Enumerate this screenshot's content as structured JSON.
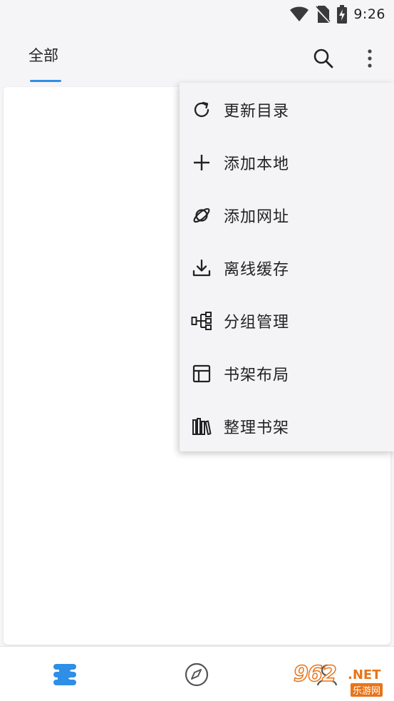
{
  "status_bar": {
    "time": "9:26",
    "icons": [
      "wifi-icon",
      "no-sim-icon",
      "battery-charging-icon"
    ]
  },
  "header": {
    "tab_label": "全部",
    "actions": [
      "search-icon",
      "more-vertical-icon"
    ]
  },
  "menu": {
    "items": [
      {
        "label": "更新目录",
        "icon": "refresh-icon"
      },
      {
        "label": "添加本地",
        "icon": "plus-icon"
      },
      {
        "label": "添加网址",
        "icon": "planet-icon"
      },
      {
        "label": "离线缓存",
        "icon": "download-icon"
      },
      {
        "label": "分组管理",
        "icon": "group-tree-icon"
      },
      {
        "label": "书架布局",
        "icon": "layout-icon"
      },
      {
        "label": "整理书架",
        "icon": "books-icon"
      }
    ]
  },
  "bottom_nav": {
    "items": [
      {
        "icon": "bookshelf-icon",
        "active": true
      },
      {
        "icon": "compass-icon",
        "active": false
      },
      {
        "icon": "person-icon",
        "active": false
      }
    ]
  },
  "watermark": {
    "main": "962",
    "suffix": ".NET",
    "sub": "乐游网"
  },
  "colors": {
    "accent": "#2f8ee6",
    "background": "#f5f5f7",
    "menu_background": "#f4f4f6",
    "watermark": "#e8741a"
  }
}
